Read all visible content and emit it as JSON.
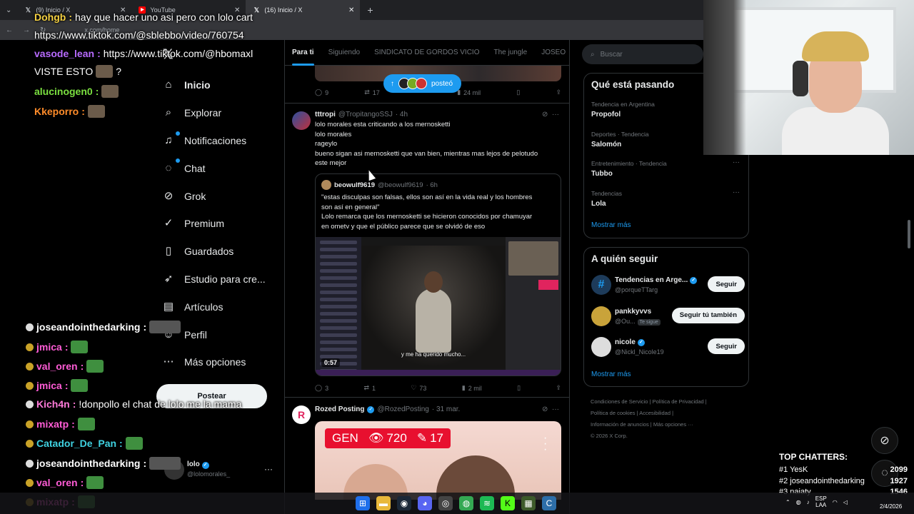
{
  "browser": {
    "tabs": [
      {
        "label": "(9) Inicio / X",
        "icon": "x-logo-icon",
        "active": false
      },
      {
        "label": "YouTube",
        "icon": "youtube-icon",
        "active": false
      },
      {
        "label": "(16) Inicio / X",
        "icon": "x-logo-icon",
        "active": true
      }
    ],
    "url": "x.com/home"
  },
  "stream_chat": [
    {
      "user": "Dohgb",
      "color": "#f5d142",
      "text": "hay que hacer uno asi pero con lolo cart"
    },
    {
      "user": "",
      "color": "#ffffff",
      "text": "https://www.tiktok.com/@sblebbo/video/760754"
    },
    {
      "user": "vasode_lean",
      "color": "#b86bff",
      "text": "https://www.tiktok.com/@hbomaxl"
    },
    {
      "user": "",
      "color": "#ffffff",
      "text": "VISTE ESTO"
    },
    {
      "user": "alucinogen0",
      "color": "#7be040",
      "text": ""
    },
    {
      "user": "Kkeporro",
      "color": "#ff8c2a",
      "text": ""
    },
    {
      "user": "joseandointhedarking",
      "color": "#ffffff",
      "text": ""
    },
    {
      "user": "jmica",
      "color": "#ff5cd6",
      "text": ""
    },
    {
      "user": "val_oren",
      "color": "#ff5cd6",
      "text": ""
    },
    {
      "user": "jmica",
      "color": "#ff5cd6",
      "text": ""
    },
    {
      "user": "Kich4n",
      "color": "#ff7ad9",
      "text": "!donpollo el chat de lolo me la mama"
    },
    {
      "user": "mixatp",
      "color": "#ff5cd6",
      "text": ""
    },
    {
      "user": "Catador_De_Pan",
      "color": "#3fd1e0",
      "text": ""
    },
    {
      "user": "joseandointhedarking",
      "color": "#ffffff",
      "text": ""
    },
    {
      "user": "val_oren",
      "color": "#ff5cd6",
      "text": ""
    },
    {
      "user": "mixatp",
      "color": "#ff5cd6",
      "text": ""
    }
  ],
  "nav": {
    "items": [
      {
        "label": "Inicio",
        "icon": "home-icon",
        "glyph": "⌂",
        "bold": true
      },
      {
        "label": "Explorar",
        "icon": "search-icon",
        "glyph": "⌕",
        "bold": false
      },
      {
        "label": "Notificaciones",
        "icon": "bell-icon",
        "glyph": "♫",
        "bold": false
      },
      {
        "label": "Chat",
        "icon": "chat-icon",
        "glyph": "◌",
        "bold": false
      },
      {
        "label": "Grok",
        "icon": "grok-icon",
        "glyph": "⊘",
        "bold": false
      },
      {
        "label": "Premium",
        "icon": "premium-icon",
        "glyph": "✓",
        "bold": false
      },
      {
        "label": "Guardados",
        "icon": "bookmark-icon",
        "glyph": "▯",
        "bold": false
      },
      {
        "label": "Estudio para cre...",
        "icon": "rocket-icon",
        "glyph": "➶",
        "bold": false
      },
      {
        "label": "Artículos",
        "icon": "article-icon",
        "glyph": "▤",
        "bold": false
      },
      {
        "label": "Perfil",
        "icon": "profile-icon",
        "glyph": "☺",
        "bold": false
      },
      {
        "label": "Más opciones",
        "icon": "more-icon",
        "glyph": "⋯",
        "bold": false
      }
    ],
    "post_label": "Postear",
    "account": {
      "name": "lolo",
      "handle": "@lolomorales_"
    }
  },
  "timeline": {
    "tabs": [
      "Para ti",
      "Siguiendo",
      "SINDICATO DE GORDOS VICIO",
      "The jungle",
      "JOSEO"
    ],
    "posted_pill": "posteó",
    "prev_actions": {
      "replies": "9",
      "reposts": "17",
      "views": "24 mil"
    },
    "tweet1": {
      "name": "tttropi",
      "handle": "@TropitangoSSJ",
      "time": "· 4h",
      "lines": [
        "lolo morales esta criticando a los mernosketti",
        "lolo morales",
        "rageylo",
        "bueno sigan asi mernosketti que van bien, mientras mas lejos de pelotudo",
        "este mejor"
      ],
      "quote": {
        "name": "beowulf9619",
        "handle": "@beowulf9619",
        "time": "· 6h",
        "lines": [
          "\"estas disculpas son falsas, ellos son así en la vida real y los hombres",
          "son así en general\"",
          "Lolo remarca que los mernosketti se hicieron conocidos por chamuyar",
          "en ometv y que el público parece que se olvidó de eso"
        ],
        "caption": "y me ha querido mucho...",
        "duration": "0:57"
      },
      "actions": {
        "replies": "3",
        "reposts": "1",
        "likes": "73",
        "views": "2 mil"
      }
    },
    "tweet2": {
      "name": "Rozed Posting",
      "handle": "@RozedPosting",
      "time": "· 31 mar.",
      "avatar_letter": "R",
      "media_badge": {
        "tag": "GEN",
        "views": "720",
        "edits": "17"
      }
    }
  },
  "right": {
    "search_placeholder": "Buscar",
    "trends_title": "Qué está pasando",
    "trends": [
      {
        "context": "Tendencia en Argentina",
        "name": "Propofol"
      },
      {
        "context": "Deportes · Tendencia",
        "name": "Salomón"
      },
      {
        "context": "Entretenimiento · Tendencia",
        "name": "Tubbo"
      },
      {
        "context": "Tendencias",
        "name": "Lola"
      }
    ],
    "show_more": "Mostrar más",
    "follow_title": "A quién seguir",
    "follow": [
      {
        "name": "Tendencias en Arge...",
        "handle": "@porqueTTarg",
        "button": "Seguir",
        "verified": true,
        "chip": ""
      },
      {
        "name": "pankkyvvs",
        "handle": "@Ou...",
        "button": "Seguir tú también",
        "verified": false,
        "chip": "Te sigue"
      },
      {
        "name": "nicole",
        "handle": "@Nickl_Nicole19",
        "button": "Seguir",
        "verified": true,
        "chip": ""
      }
    ],
    "show_more_2": "Mostrar más",
    "footer": [
      "Condiciones de Servicio  |  Política de Privacidad  |",
      "Política de cookies  |  Accesibilidad  |",
      "Información de anuncios  |  Más opciones ···",
      "© 2026 X Corp."
    ]
  },
  "top_chatters": {
    "title": "TOP CHATTERS:",
    "rows": [
      {
        "label": "#1 YesK",
        "count": "2099"
      },
      {
        "label": "#2 joseandointhedarking",
        "count": "1927"
      },
      {
        "label": "#3 naiaty",
        "count": "1546"
      }
    ]
  },
  "taskbar": {
    "lang": "ESP",
    "lang2": "LAA",
    "date": "2/4/2026"
  },
  "colors": {
    "accent": "#1d9bf0",
    "background": "#000000",
    "border": "#2f3336"
  }
}
